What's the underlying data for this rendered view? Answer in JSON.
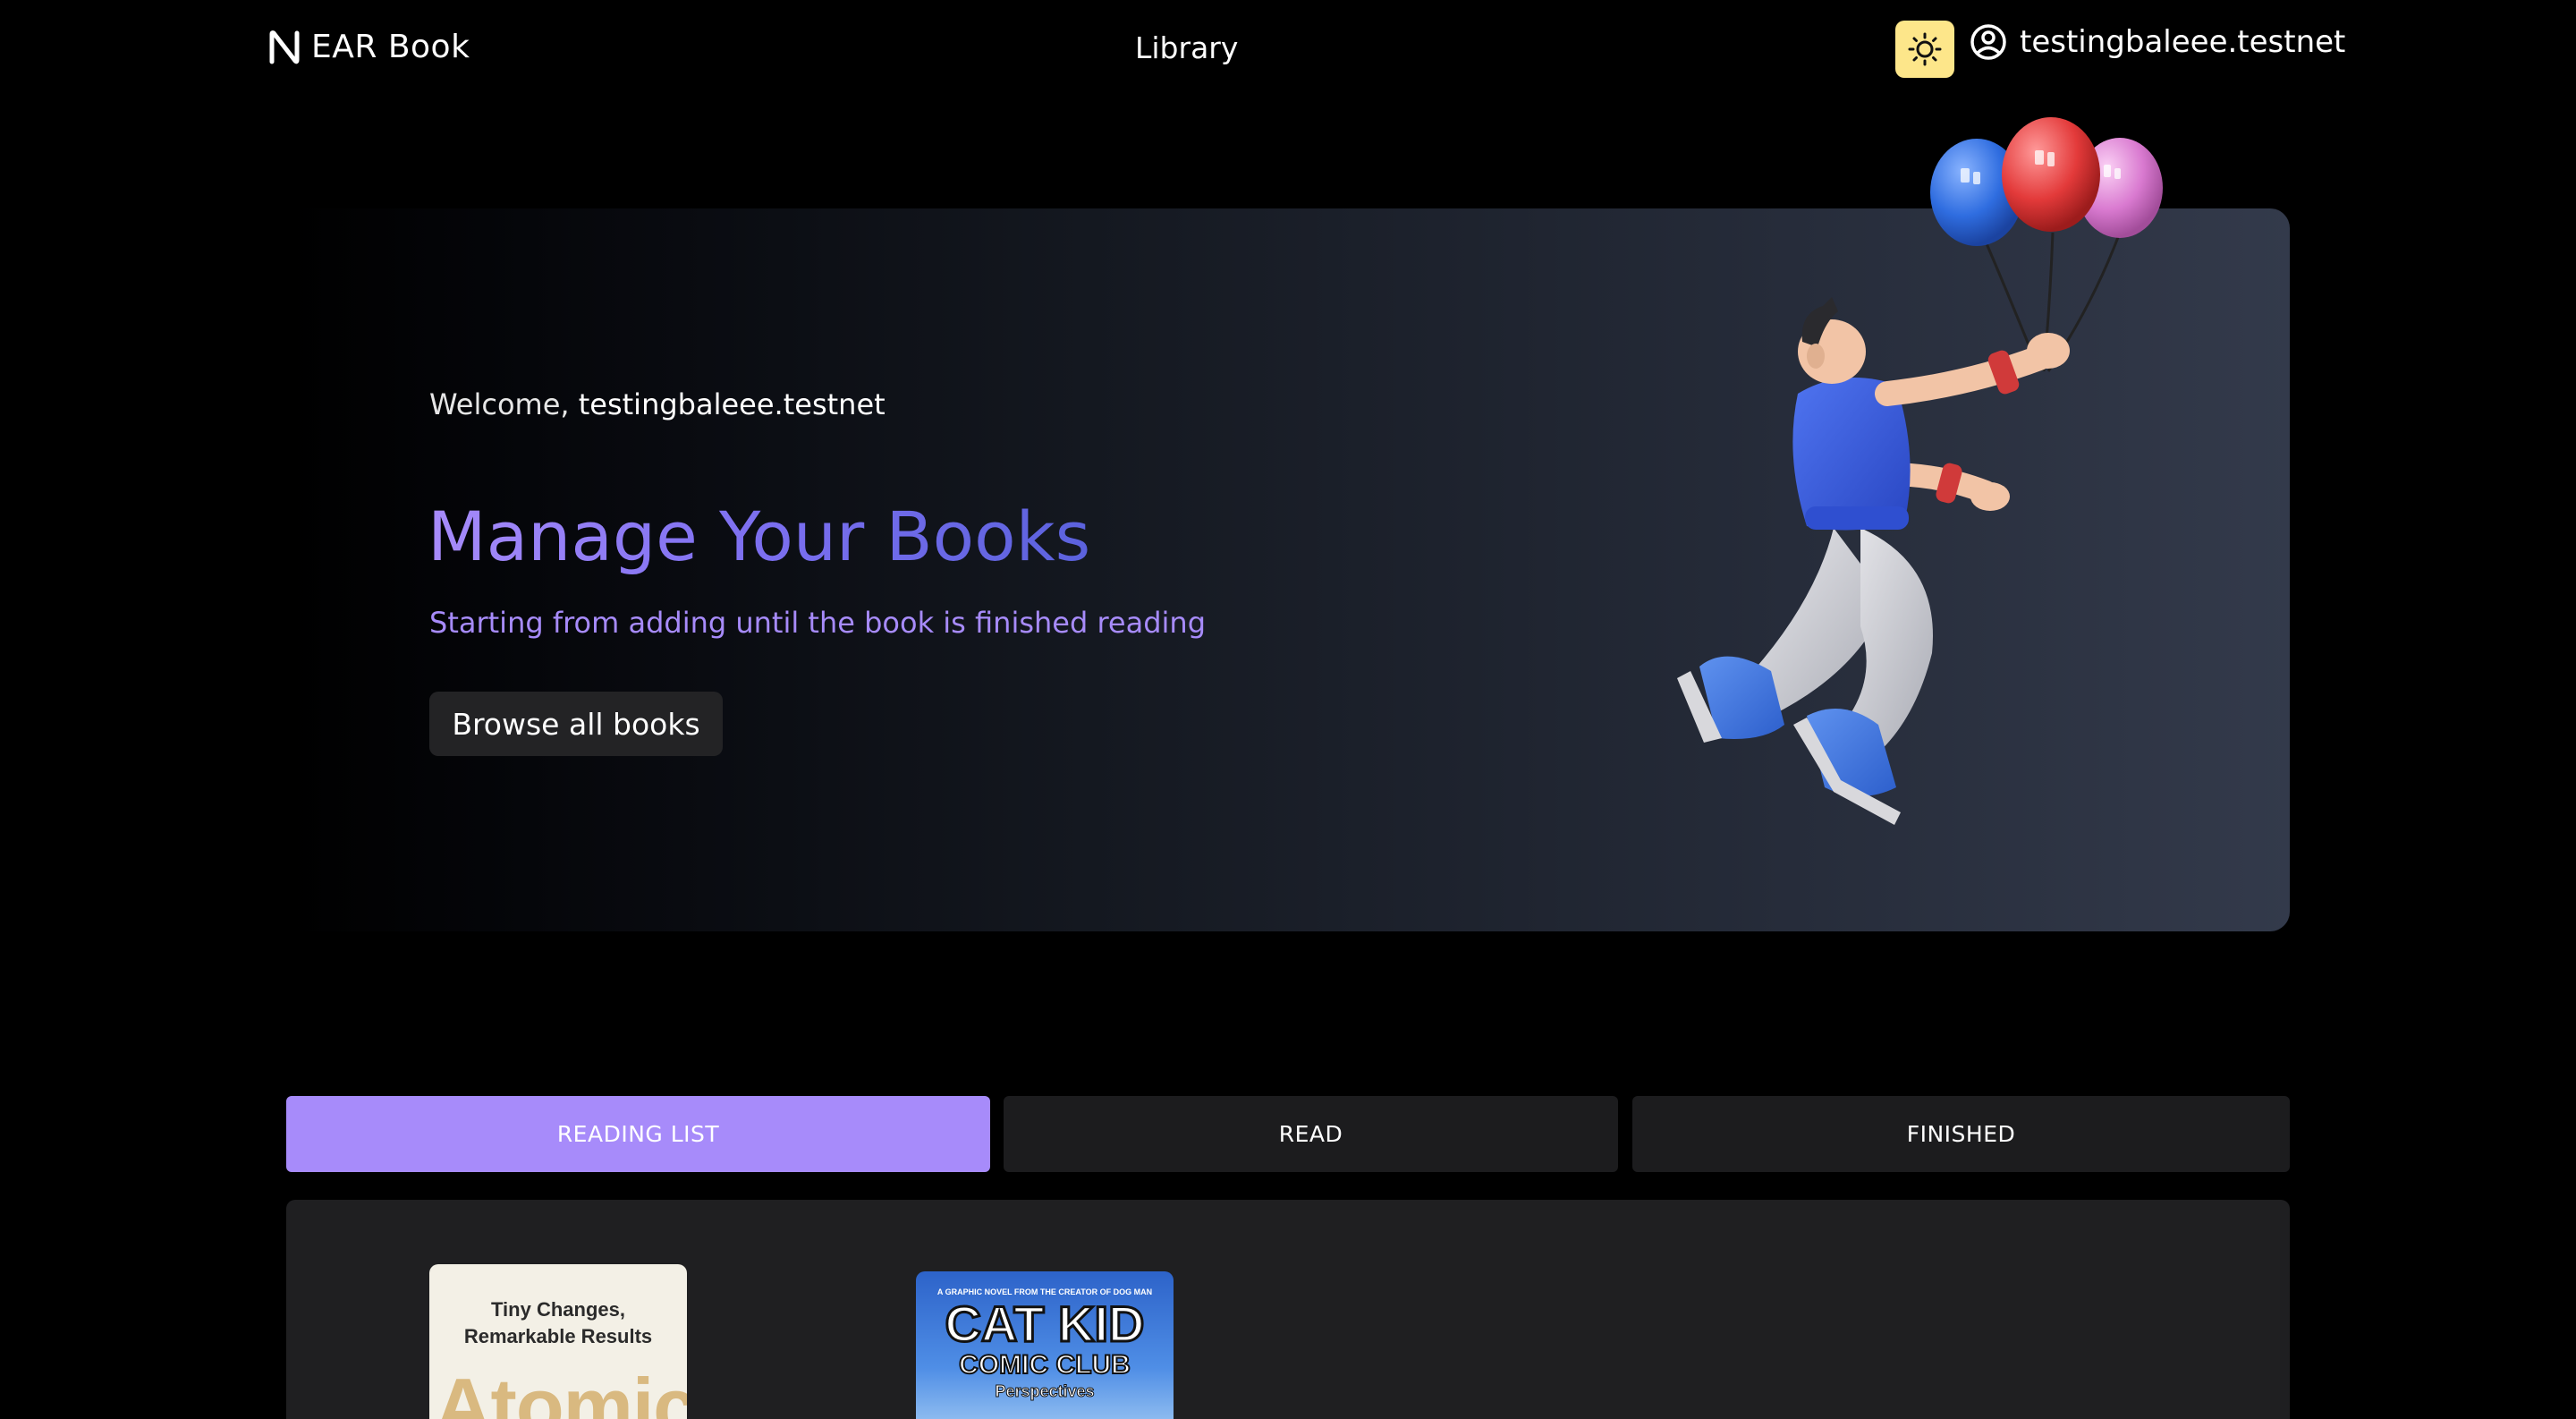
{
  "header": {
    "logo_text": "EAR Book",
    "nav_library": "Library",
    "username": "testingbaleee.testnet"
  },
  "hero": {
    "welcome_prefix": "Welcome, ",
    "welcome_user": "testingbaleee.testnet",
    "title": "Manage Your Books",
    "subtitle": "Starting from adding until the book is finished reading",
    "browse_button": "Browse all books"
  },
  "tabs": [
    {
      "label": "READING LIST",
      "active": true
    },
    {
      "label": "READ",
      "active": false
    },
    {
      "label": "FINISHED",
      "active": false
    }
  ],
  "books": [
    {
      "tagline_line1": "Tiny Changes,",
      "tagline_line2": "Remarkable Results",
      "title_visible": "Atomic"
    },
    {
      "top_line": "A GRAPHIC NOVEL FROM THE CREATOR OF DOG MAN",
      "title": "CAT KID",
      "subtitle": "COMIC CLUB",
      "series": "Perspectives"
    }
  ],
  "colors": {
    "accent": "#a78bfa",
    "theme_toggle": "#fde68a",
    "tab_inactive": "#1c1c1e"
  },
  "icons": {
    "logo": "near-logo-icon",
    "theme": "sun-icon",
    "user": "user-circle-icon"
  }
}
